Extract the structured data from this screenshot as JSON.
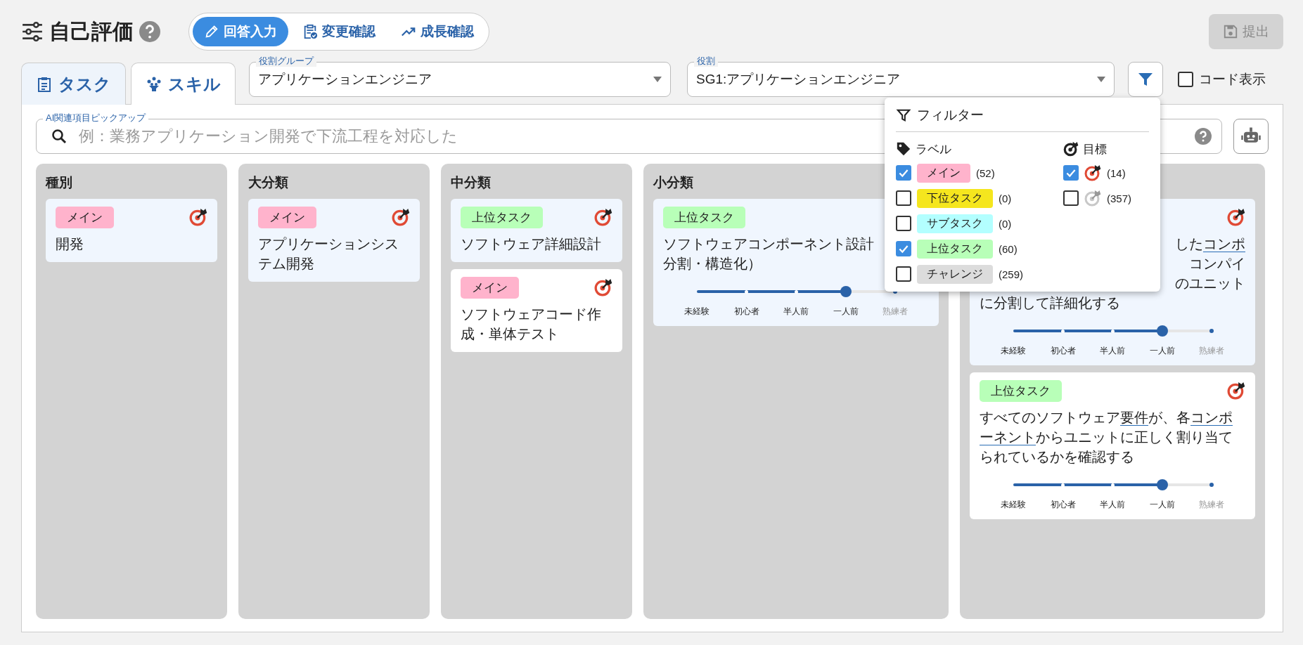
{
  "header": {
    "title": "自己評価",
    "modes": [
      {
        "label": "回答入力",
        "selected": true
      },
      {
        "label": "変更確認",
        "selected": false
      },
      {
        "label": "成長確認",
        "selected": false
      }
    ],
    "submit": {
      "label": "提出",
      "disabled": true
    }
  },
  "tabs": [
    {
      "label": "タスク",
      "selected": true
    },
    {
      "label": "スキル",
      "selected": false
    }
  ],
  "role_group": {
    "label": "役割グループ",
    "value": "アプリケーションエンジニア"
  },
  "role": {
    "label": "役割",
    "value": "SG1:アプリケーションエンジニア"
  },
  "code_display": {
    "label": "コード表示",
    "checked": false
  },
  "search": {
    "label": "AI関連項目ピックアップ",
    "placeholder": "例：業務アプリケーション開発で下流工程を対応した"
  },
  "columns": [
    {
      "title": "種別",
      "cards": [
        {
          "label": {
            "text": "メイン",
            "color": "#ffb3cc"
          },
          "goal": true,
          "highlighted": true,
          "lines": [
            {
              "segments": [
                {
                  "text": "開発"
                }
              ]
            }
          ]
        }
      ]
    },
    {
      "title": "大分類",
      "cards": [
        {
          "label": {
            "text": "メイン",
            "color": "#ffb3cc"
          },
          "goal": true,
          "highlighted": true,
          "lines": [
            {
              "segments": [
                {
                  "text": "アプリケーションシス"
                }
              ]
            },
            {
              "segments": [
                {
                  "text": "テム開発"
                }
              ]
            }
          ]
        }
      ]
    },
    {
      "title": "中分類",
      "cards": [
        {
          "label": {
            "text": "上位タスク",
            "color": "#b8ffb8"
          },
          "goal": true,
          "highlighted": true,
          "lines": [
            {
              "segments": [
                {
                  "text": "ソフトウェア詳細設計"
                }
              ]
            }
          ]
        },
        {
          "label": {
            "text": "メイン",
            "color": "#ffb3cc"
          },
          "goal": true,
          "highlighted": false,
          "lines": [
            {
              "segments": [
                {
                  "text": "ソフトウェアコード作"
                }
              ]
            },
            {
              "segments": [
                {
                  "text": "成・単体テスト"
                }
              ]
            }
          ]
        }
      ]
    },
    {
      "title": "小分類",
      "cards": [
        {
          "label": {
            "text": "上位タスク",
            "color": "#b8ffb8"
          },
          "highlighted": true,
          "lines": [
            {
              "segments": [
                {
                  "text": "ソフトウェアコンポーネント設計"
                }
              ]
            },
            {
              "segments": [
                {
                  "text": "分割・構造化）"
                }
              ]
            }
          ],
          "scale": {
            "level": 0.75,
            "labels": [
              "未経験",
              "初心者",
              "半人前",
              "一人前",
              "熟練者"
            ]
          }
        }
      ]
    },
    {
      "cards": [
        {
          "goal": true,
          "highlighted": true,
          "lines": [
            {
              "cut": true,
              "segments": [
                {
                  "text": "した"
                },
                {
                  "text": "コンポ",
                  "link": true
                }
              ]
            },
            {
              "cut": true,
              "segments": [
                {
                  "text": "コンパイ"
                }
              ]
            },
            {
              "cut": true,
              "segments": [
                {
                  "text": "のユニット"
                }
              ]
            },
            {
              "segments": [
                {
                  "text": "に分割して詳細化する"
                }
              ]
            }
          ],
          "scale": {
            "level": 0.75,
            "labels": [
              "未経験",
              "初心者",
              "半人前",
              "一人前",
              "熟練者"
            ]
          }
        },
        {
          "label": {
            "text": "上位タスク",
            "color": "#b8ffb8"
          },
          "goal": true,
          "highlighted": false,
          "lines": [
            {
              "segments": [
                {
                  "text": "すべてのソフトウェア"
                },
                {
                  "text": "要件",
                  "link": true
                },
                {
                  "text": "が、各"
                },
                {
                  "text": "コンポ",
                  "link": true
                }
              ]
            },
            {
              "segments": [
                {
                  "text": "ーネント",
                  "link": true
                },
                {
                  "text": "からユニットに正しく割り当て"
                }
              ]
            },
            {
              "segments": [
                {
                  "text": "られているかを確認する"
                }
              ]
            }
          ],
          "scale": {
            "level": 0.75,
            "labels": [
              "未経験",
              "初心者",
              "半人前",
              "一人前",
              "熟練者"
            ]
          }
        }
      ]
    }
  ],
  "filter": {
    "title": "フィルター",
    "label_heading": "ラベル",
    "goal_heading": "目標",
    "labels": [
      {
        "text": "メイン",
        "color": "#ffb3cc",
        "count": "(52)",
        "checked": true
      },
      {
        "text": "下位タスク",
        "color": "#f5e61e",
        "count": "(0)",
        "checked": false
      },
      {
        "text": "サブタスク",
        "color": "#b3ffff",
        "count": "(0)",
        "checked": false
      },
      {
        "text": "上位タスク",
        "color": "#b8ffb8",
        "count": "(60)",
        "checked": true
      },
      {
        "text": "チャレンジ",
        "color": "#dcdcdc",
        "count": "(259)",
        "checked": false
      }
    ],
    "goals": [
      {
        "goal": true,
        "count": "(14)",
        "checked": true
      },
      {
        "goal": false,
        "count": "(357)",
        "checked": false
      }
    ]
  }
}
